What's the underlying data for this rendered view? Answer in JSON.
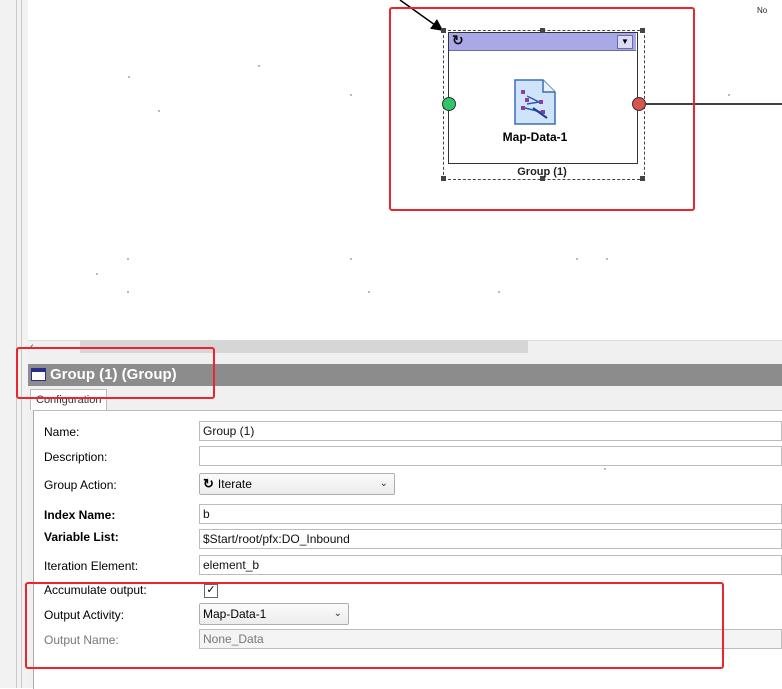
{
  "canvas": {
    "corner_text": "No",
    "group_label": "Group (1)",
    "activity_label": "Map-Data-1"
  },
  "panel": {
    "title": "Group (1) (Group)",
    "tabs": [
      {
        "label": "Configuration"
      }
    ]
  },
  "form": {
    "name": {
      "label": "Name:",
      "value": "Group (1)"
    },
    "description": {
      "label": "Description:",
      "value": ""
    },
    "group_action": {
      "label": "Group Action:",
      "value": "Iterate"
    },
    "index_name": {
      "label": "Index Name:",
      "value": "b"
    },
    "variable_list": {
      "label": "Variable List:",
      "value": "$Start/root/pfx:DO_Inbound"
    },
    "iteration_element": {
      "label": "Iteration Element:",
      "value": "element_b"
    },
    "accumulate_output": {
      "label": "Accumulate output:",
      "checked": true
    },
    "output_activity": {
      "label": "Output Activity:",
      "value": "Map-Data-1"
    },
    "output_name": {
      "label": "Output Name:",
      "value": "None_Data"
    }
  },
  "colors": {
    "highlight": "#e8262b",
    "group_header": "#a9a9e8",
    "start_port": "#2fc66a",
    "end_port": "#d9534f"
  }
}
